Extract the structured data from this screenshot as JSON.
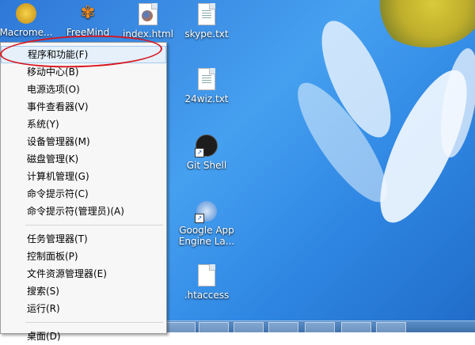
{
  "desktop": {
    "icons": [
      {
        "label": "Macrome...",
        "icon": "macromedia-shortcut-icon"
      },
      {
        "label": "FreeMind",
        "icon": "freemind-butterfly-icon"
      },
      {
        "label": "index.html",
        "icon": "firefox-html-file-icon"
      },
      {
        "label": "skype.txt",
        "icon": "text-file-icon"
      },
      {
        "label": "24wiz.txt",
        "icon": "text-file-icon"
      },
      {
        "label": "Git Shell",
        "icon": "git-shell-shortcut-icon"
      },
      {
        "label": "Google App Engine La...",
        "icon": "google-app-engine-shortcut-icon"
      },
      {
        "label": ".htaccess",
        "icon": "blank-file-icon"
      }
    ]
  },
  "context_menu": {
    "group1": [
      "程序和功能(F)",
      "移动中心(B)",
      "电源选项(O)",
      "事件查看器(V)",
      "系统(Y)",
      "设备管理器(M)",
      "磁盘管理(K)",
      "计算机管理(G)",
      "命令提示符(C)",
      "命令提示符(管理员)(A)"
    ],
    "group2": [
      "任务管理器(T)",
      "控制面板(P)",
      "文件资源管理器(E)",
      "搜索(S)",
      "运行(R)"
    ],
    "group3": [
      "桌面(D)"
    ],
    "highlighted_item": "程序和功能(F)"
  },
  "colors": {
    "annotation_ellipse": "#d7171f",
    "menu_highlight": "#e5f0fb"
  }
}
